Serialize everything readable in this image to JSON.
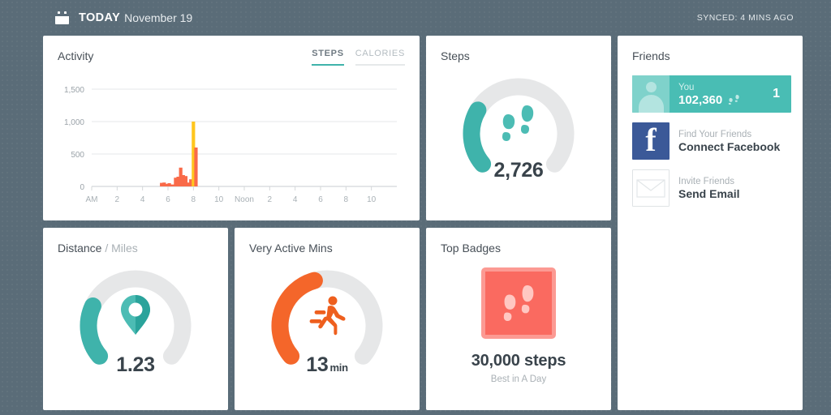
{
  "header": {
    "calendar_icon": "calendar-icon",
    "today_label": "TODAY",
    "date": "November 19",
    "sync_status": "SYNCED: 4 MINS AGO"
  },
  "colors": {
    "page_background": "#5a6c78",
    "teal": "#3fb3ab",
    "teal_light": "#49bdb4",
    "orange": "#f4662a",
    "track_gray": "#e6e7e8",
    "coral": "#fa6a60",
    "coral_light": "#fc9a93",
    "facebook_blue": "#3b5998",
    "chart_orange": "#f96a49",
    "chart_yellow": "#ffc61e"
  },
  "activity": {
    "title": "Activity",
    "tabs": [
      {
        "label": "STEPS",
        "active": true
      },
      {
        "label": "CALORIES",
        "active": false
      }
    ]
  },
  "chart_data": {
    "type": "bar",
    "title": "Activity",
    "xlabel": "",
    "ylabel": "",
    "ylim": [
      0,
      1600
    ],
    "yticks": [
      0,
      500,
      1000,
      1500
    ],
    "ytick_labels": [
      "0",
      "500",
      "1,000",
      "1,500"
    ],
    "xlim": [
      0,
      24
    ],
    "xticks": [
      0,
      2,
      4,
      6,
      8,
      10,
      12,
      14,
      16,
      18,
      20,
      22
    ],
    "xtick_labels": [
      "AM",
      "2",
      "4",
      "6",
      "8",
      "10",
      "Noon",
      "2",
      "4",
      "6",
      "8",
      "10"
    ],
    "grid": "horizontal",
    "legend": "none",
    "bar_color": "#f96a49",
    "highlight_color": "#ffc61e",
    "x": [
      5.5,
      5.7,
      5.9,
      6.1,
      6.35,
      6.6,
      6.8,
      7.0,
      7.2,
      7.4,
      7.6,
      7.8,
      8.0,
      8.2
    ],
    "values": [
      55,
      60,
      40,
      50,
      30,
      135,
      150,
      290,
      175,
      160,
      60,
      110,
      1000,
      600
    ],
    "highlight_index": 12
  },
  "steps": {
    "title": "Steps",
    "icon": "footprints-icon",
    "value": "2,726",
    "progress_percent": 27
  },
  "distance": {
    "title_main": "Distance",
    "title_sep": " / ",
    "title_unit": "Miles",
    "icon": "map-pin-icon",
    "value": "1.23",
    "progress_percent": 25
  },
  "very_active": {
    "title": "Very Active Mins",
    "icon": "running-person-icon",
    "value": "13",
    "unit": "min",
    "progress_percent": 44
  },
  "top_badges": {
    "title": "Top Badges",
    "badge_icon": "footprints-badge-icon",
    "badge_title": "30,000 steps",
    "badge_subtitle": "Best in A Day"
  },
  "friends": {
    "title": "Friends",
    "rows": [
      {
        "avatar": "person-avatar-icon",
        "top_label": "You",
        "bottom_label": "102,360",
        "rank": "1",
        "highlighted": true
      },
      {
        "avatar": "facebook-icon",
        "top_label": "Find Your Friends",
        "bottom_label": "Connect Facebook",
        "highlighted": false
      },
      {
        "avatar": "envelope-icon",
        "top_label": "Invite Friends",
        "bottom_label": "Send Email",
        "highlighted": false
      }
    ]
  }
}
